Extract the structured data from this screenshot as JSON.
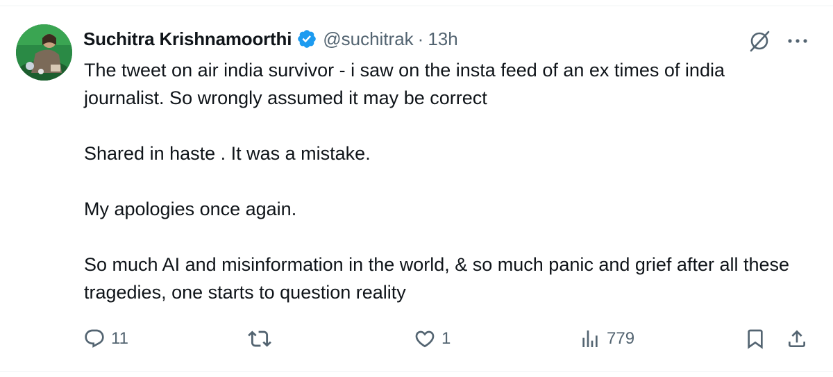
{
  "tweet": {
    "author": {
      "display_name": "Suchitra Krishnamoorthi",
      "handle": "@suchitrak",
      "separator": "·",
      "time": "13h",
      "verified": true
    },
    "text": {
      "p1": "The tweet on air india survivor - i saw on the insta feed of an ex times of india journalist. So wrongly assumed it may be correct",
      "p2": "Shared in haste . It was a mistake.",
      "p3": "My apologies once again.",
      "p4": "So much AI and misinformation in the world, & so much panic and grief after all these tragedies, one starts to question reality"
    },
    "actions": {
      "replies": "11",
      "retweets": "",
      "likes": "1",
      "views": "779"
    }
  },
  "colors": {
    "text_primary": "#0f1419",
    "text_secondary": "#536471",
    "verified_blue": "#1d9bf0",
    "divider": "#eff3f4"
  },
  "icons": {
    "verified": "verified-badge-icon",
    "grok": "grok-icon",
    "more": "more-icon",
    "reply": "reply-icon",
    "retweet": "retweet-icon",
    "like": "heart-icon",
    "views": "views-icon",
    "bookmark": "bookmark-icon",
    "share": "share-icon"
  }
}
